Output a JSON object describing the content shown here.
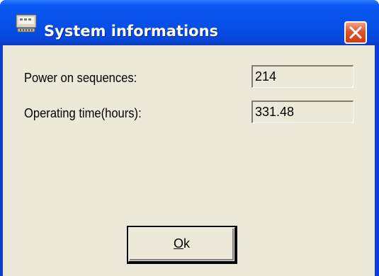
{
  "window": {
    "title": "System informations",
    "icon": "computer-icon",
    "close_icon": "close-icon",
    "colors": {
      "titlebar": "#0751e8",
      "client": "#ece9d8",
      "close_button": "#e0562e"
    }
  },
  "fields": [
    {
      "label": "Power on sequences:",
      "value": "214"
    },
    {
      "label": "Operating time(hours):",
      "value": "331.48"
    }
  ],
  "ok_button": {
    "mnemonic": "O",
    "rest": "k"
  }
}
